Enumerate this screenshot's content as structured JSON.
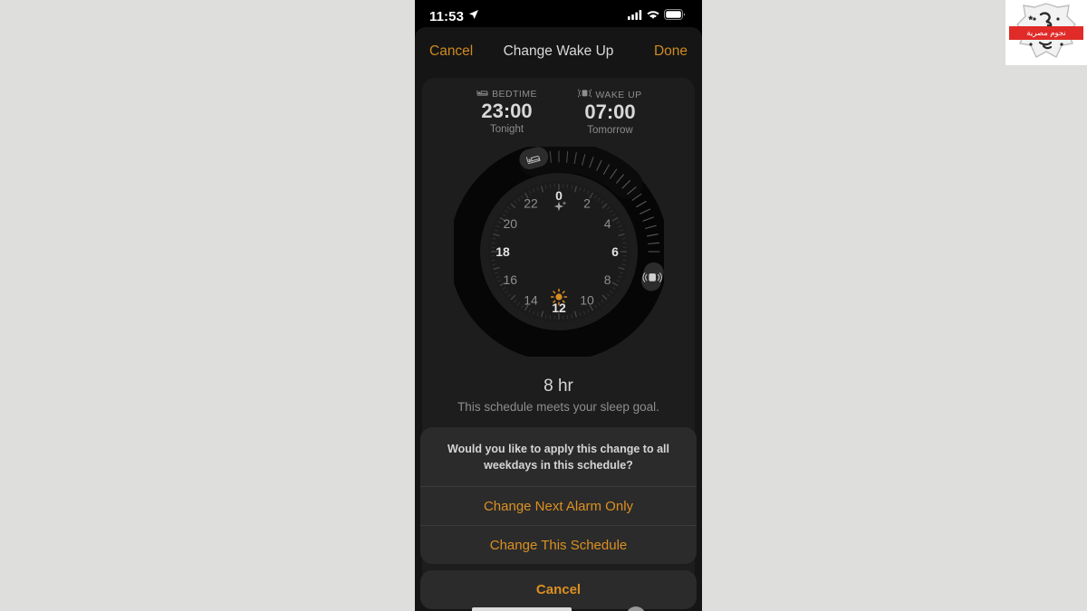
{
  "accent_color": "#dd9021",
  "status_bar": {
    "time": "11:53",
    "location_icon": "location-arrow-icon",
    "cellular_icon": "cellular-signal-icon",
    "wifi_icon": "wifi-icon",
    "battery_icon": "battery-icon"
  },
  "navbar": {
    "cancel_label": "Cancel",
    "title": "Change Wake Up",
    "done_label": "Done"
  },
  "summary": {
    "bedtime": {
      "icon": "bed-icon",
      "label": "BEDTIME",
      "time": "23:00",
      "day": "Tonight"
    },
    "wakeup": {
      "icon": "alarm-bell-icon",
      "label": "WAKE UP",
      "time": "07:00",
      "day": "Tomorrow"
    }
  },
  "dial": {
    "hour_labels": [
      "0",
      "2",
      "4",
      "6",
      "8",
      "10",
      "12",
      "14",
      "16",
      "18",
      "20",
      "22"
    ],
    "night_icon": "sparkles-icon",
    "day_icon": "sun-icon",
    "bedtime_handle_icon": "bed-icon",
    "wakeup_handle_icon": "alarm-bell-icon",
    "bedtime_hour": 23,
    "wakeup_hour": 7
  },
  "duration": {
    "value": "8 hr",
    "note": "This schedule meets your sleep goal."
  },
  "action_sheet": {
    "message": "Would you like to apply this change to all weekdays in this schedule?",
    "options": [
      "Change Next Alarm Only",
      "Change This Schedule"
    ],
    "cancel_label": "Cancel"
  },
  "watermark": {
    "text": "نجوم مصرية"
  }
}
